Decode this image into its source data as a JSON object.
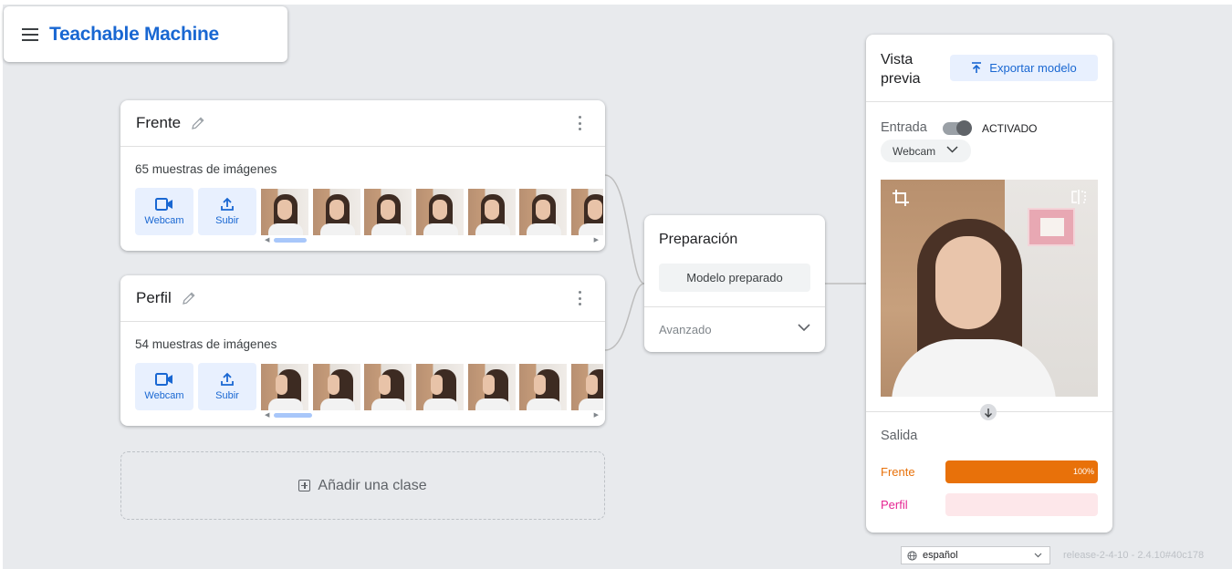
{
  "app": {
    "title": "Teachable Machine"
  },
  "classes": [
    {
      "name": "Frente",
      "samples": "65 muestras de imágenes",
      "webcam_label": "Webcam",
      "upload_label": "Subir"
    },
    {
      "name": "Perfil",
      "samples": "54 muestras de imágenes",
      "webcam_label": "Webcam",
      "upload_label": "Subir"
    }
  ],
  "add_class_label": "Añadir una clase",
  "training": {
    "title": "Preparación",
    "button_label": "Modelo preparado",
    "advanced_label": "Avanzado"
  },
  "preview": {
    "title": "Vista previa",
    "export_label": "Exportar modelo",
    "input_label": "Entrada",
    "toggle_state": "ACTIVADO",
    "input_source": "Webcam",
    "output_label": "Salida",
    "outputs": [
      {
        "name": "Frente",
        "value": 1.0,
        "percent_label": "100%",
        "color": "#e8710a",
        "track_color": "#fce0c8"
      },
      {
        "name": "Perfil",
        "value": 0.0,
        "percent_label": "",
        "color": "#e52592",
        "track_color": "#fde7ea"
      }
    ]
  },
  "footer": {
    "language": "español",
    "release": "release-2-4-10 - 2.4.10#40c178"
  },
  "colors": {
    "accent": "#1967d2",
    "accent_bg": "#e8f0fe",
    "frente": "#e8710a",
    "perfil": "#e52592"
  }
}
